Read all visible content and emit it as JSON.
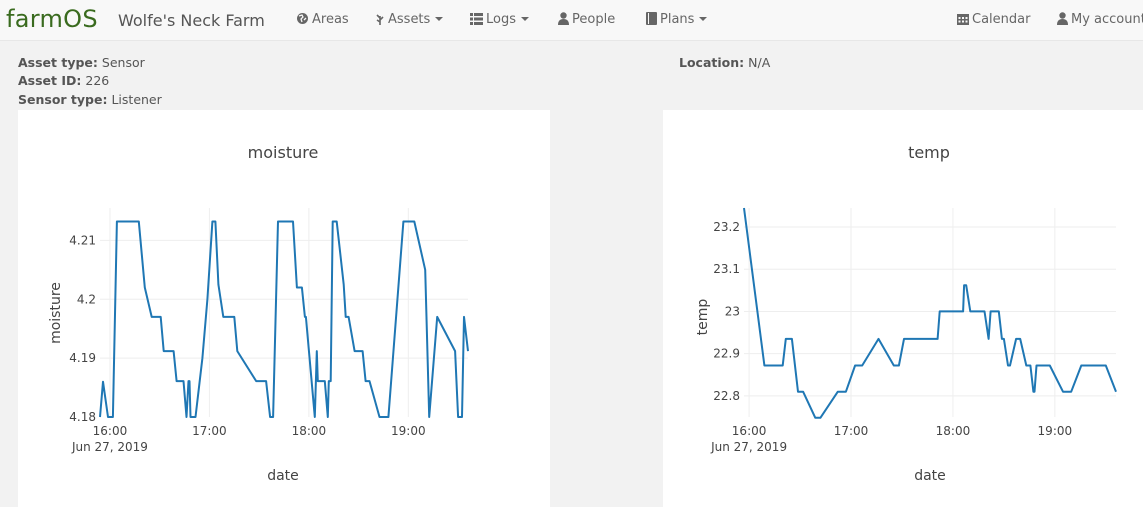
{
  "header": {
    "logo": "farmOS",
    "site_name": "Wolfe's Neck Farm",
    "nav": {
      "areas": "Areas",
      "assets": "Assets",
      "logs": "Logs",
      "people": "People",
      "plans": "Plans",
      "calendar": "Calendar",
      "account": "My account"
    }
  },
  "asset": {
    "type_label": "Asset type:",
    "type_value": "Sensor",
    "id_label": "Asset ID:",
    "id_value": "226",
    "sensor_label": "Sensor type:",
    "sensor_value": "Listener",
    "location_label": "Location:",
    "location_value": "N/A"
  },
  "colors": {
    "line": "#1f77b4",
    "grid": "#eeeeee",
    "brand": "#3a6b1f"
  },
  "chart_data": [
    {
      "type": "line",
      "title": "moisture",
      "xlabel": "date",
      "ylabel": "moisture",
      "date_label": "Jun 27, 2019",
      "x_tick_labels": [
        "16:00",
        "17:00",
        "18:00",
        "19:00"
      ],
      "x_ticks_hours": [
        16,
        17,
        18,
        19
      ],
      "xlim_hours": [
        15.9,
        19.6
      ],
      "y_tick_labels": [
        "4.18",
        "4.19",
        "4.2",
        "4.21"
      ],
      "y_ticks": [
        4.18,
        4.19,
        4.2,
        4.21
      ],
      "ylim": [
        4.18,
        4.2155
      ],
      "series": [
        {
          "x_hours": [
            15.9,
            15.93,
            15.98,
            16.03,
            16.07,
            16.12,
            16.29,
            16.35,
            16.42,
            16.51,
            16.54,
            16.64,
            16.67,
            16.74,
            16.77,
            16.79,
            16.8,
            16.81,
            16.83,
            16.86,
            16.93,
            16.98,
            17.03,
            17.06,
            17.09,
            17.14,
            17.25,
            17.28,
            17.47,
            17.57,
            17.61,
            17.64,
            17.69,
            17.76,
            17.84,
            17.88,
            17.93,
            17.96,
            17.97,
            18.06,
            18.08,
            18.09,
            18.16,
            18.19,
            18.2,
            18.22,
            18.24,
            18.28,
            18.35,
            18.37,
            18.4,
            18.46,
            18.54,
            18.57,
            18.61,
            18.71,
            18.8,
            18.95,
            18.99,
            19.06,
            19.17,
            19.21,
            19.29,
            19.47,
            19.5,
            19.54,
            19.56,
            19.6
          ],
          "y": [
            4.18,
            4.186,
            4.18,
            4.18,
            4.2132,
            4.2132,
            4.2132,
            4.202,
            4.197,
            4.197,
            4.1912,
            4.1912,
            4.1861,
            4.1861,
            4.18,
            4.1861,
            4.1861,
            4.18,
            4.18,
            4.18,
            4.19,
            4.2,
            4.2132,
            4.2132,
            4.2025,
            4.197,
            4.197,
            4.1912,
            4.1861,
            4.1861,
            4.18,
            4.18,
            4.2132,
            4.2132,
            4.2132,
            4.202,
            4.202,
            4.197,
            4.197,
            4.18,
            4.1912,
            4.1861,
            4.1861,
            4.18,
            4.1861,
            4.1861,
            4.2132,
            4.2132,
            4.2025,
            4.197,
            4.197,
            4.1912,
            4.1912,
            4.1861,
            4.1861,
            4.18,
            4.18,
            4.2132,
            4.2132,
            4.2132,
            4.205,
            4.18,
            4.197,
            4.1912,
            4.18,
            4.18,
            4.197,
            4.1912
          ]
        }
      ]
    },
    {
      "type": "line",
      "title": "temp",
      "xlabel": "date",
      "ylabel": "temp",
      "date_label": "Jun 27, 2019",
      "x_tick_labels": [
        "16:00",
        "17:00",
        "18:00",
        "19:00"
      ],
      "x_ticks_hours": [
        16,
        17,
        18,
        19
      ],
      "xlim_hours": [
        15.95,
        19.6
      ],
      "y_tick_labels": [
        "22.8",
        "22.9",
        "23",
        "23.1",
        "23.2"
      ],
      "y_ticks": [
        22.8,
        22.9,
        23.0,
        23.1,
        23.2
      ],
      "ylim": [
        22.75,
        23.245
      ],
      "series": [
        {
          "x_hours": [
            15.95,
            16.15,
            16.19,
            16.33,
            16.36,
            16.42,
            16.48,
            16.53,
            16.65,
            16.7,
            16.87,
            16.95,
            17.04,
            17.07,
            17.11,
            17.27,
            17.42,
            17.47,
            17.52,
            17.56,
            17.82,
            17.85,
            17.87,
            18.04,
            18.1,
            18.11,
            18.13,
            18.17,
            18.24,
            18.31,
            18.35,
            18.37,
            18.45,
            18.48,
            18.5,
            18.54,
            18.56,
            18.62,
            18.66,
            18.72,
            18.76,
            18.79,
            18.8,
            18.82,
            18.87,
            18.89,
            18.91,
            18.95,
            19.08,
            19.16,
            19.26,
            19.35,
            19.38,
            19.47,
            19.5,
            19.6
          ],
          "y": [
            23.245,
            22.872,
            22.872,
            22.872,
            22.935,
            22.935,
            22.81,
            22.81,
            22.748,
            22.748,
            22.81,
            22.81,
            22.872,
            22.872,
            22.872,
            22.935,
            22.872,
            22.872,
            22.935,
            22.935,
            22.935,
            22.935,
            23.0,
            23.0,
            23.0,
            23.062,
            23.062,
            23.0,
            23.0,
            23.0,
            22.935,
            23.0,
            23.0,
            22.935,
            22.935,
            22.872,
            22.872,
            22.935,
            22.935,
            22.872,
            22.872,
            22.81,
            22.81,
            22.872,
            22.872,
            22.872,
            22.872,
            22.872,
            22.81,
            22.81,
            22.872,
            22.872,
            22.872,
            22.872,
            22.872,
            22.81
          ]
        }
      ]
    }
  ]
}
